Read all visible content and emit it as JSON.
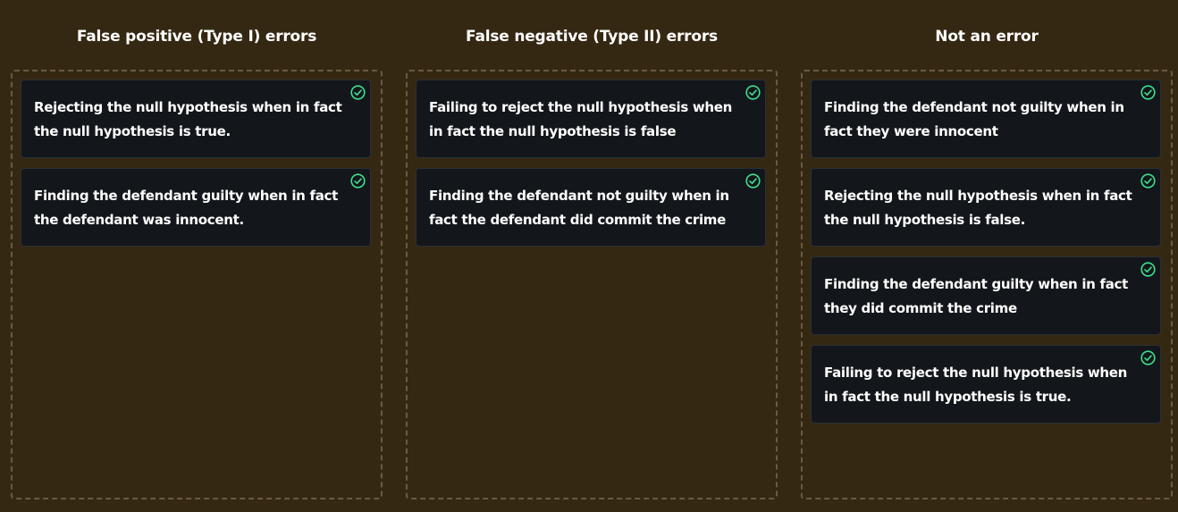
{
  "columns": [
    {
      "title": "False positive (Type I) errors",
      "cards": [
        "Rejecting the null hypothesis when in fact the null hypothesis is true.",
        "Finding the defendant guilty when in fact the defendant was innocent."
      ]
    },
    {
      "title": "False negative (Type II) errors",
      "cards": [
        "Failing to reject the null hypothesis when in fact the null hypothesis is false",
        "Finding the defendant not guilty when in fact the defendant did commit the crime"
      ]
    },
    {
      "title": "Not an error",
      "cards": [
        "Finding the defendant not guilty when in fact they were innocent",
        "Rejecting the null hypothesis when in fact the null hypothesis is false.",
        "Finding the defendant guilty when in fact they did commit the crime",
        "Failing to reject the null hypothesis when in fact the null hypothesis is true."
      ]
    }
  ],
  "colors": {
    "background": "#352812",
    "card": "#13171b",
    "check": "#3ee08f",
    "dashed_border": "#6a5a40"
  },
  "icons": {
    "card_status": "check-circle-icon"
  }
}
